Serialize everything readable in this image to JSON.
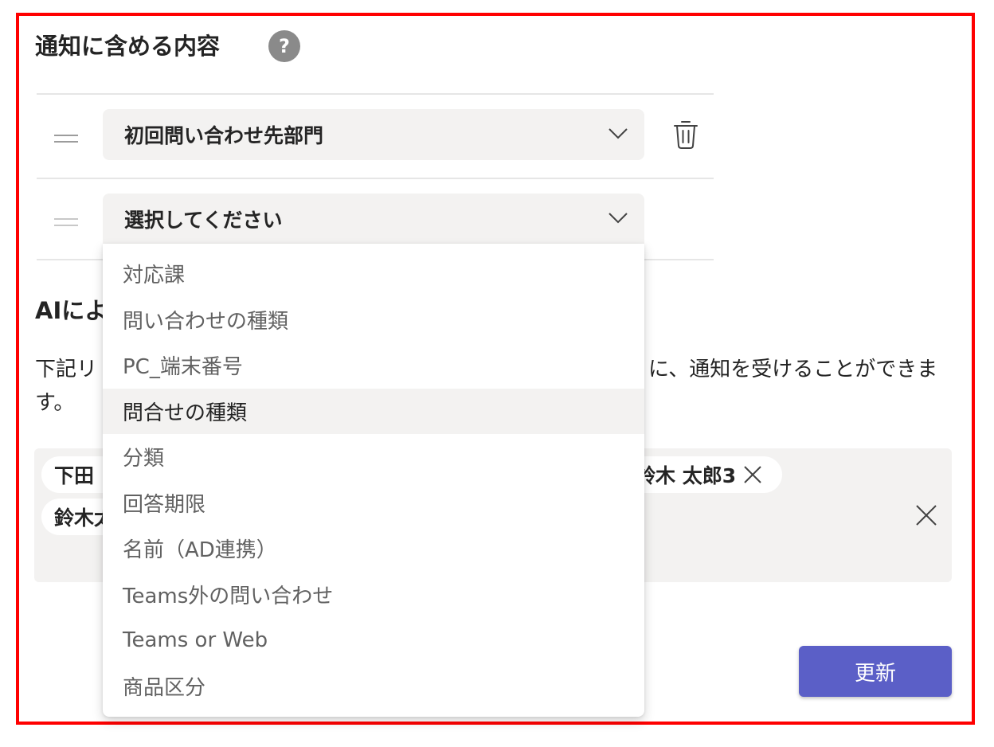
{
  "section": {
    "title": "通知に含める内容",
    "help_icon": "?"
  },
  "fields": [
    {
      "selected": "初回問い合わせ先部門",
      "icons": [
        "drag-handle-icon",
        "chevron-down-icon",
        "trash-icon"
      ]
    },
    {
      "selected": "選択してください",
      "icons": [
        "drag-handle-icon",
        "chevron-down-icon"
      ]
    }
  ],
  "dropdown": {
    "options": [
      "対応課",
      "問い合わせの種類",
      "PC_端末番号",
      "問合せの種類",
      "分類",
      "回答期限",
      "名前（AD連携）",
      "Teams外の問い合わせ",
      "Teams or Web",
      "商品区分"
    ],
    "hovered_index": 3
  },
  "ai_section": {
    "heading_visible": "AIによ",
    "description_line1_left": "下記リ",
    "description_line1_right": "に、通知を受けることができま",
    "description_line2": "す。"
  },
  "recipients": {
    "chips": [
      {
        "label": "下田"
      },
      {
        "label": "鈴木 太郎3"
      },
      {
        "label": "鈴木太"
      }
    ]
  },
  "actions": {
    "update_label": "更新"
  },
  "colors": {
    "primary": "#5b5fc7",
    "field_bg": "#f3f2f1",
    "frame_border": "#ff0000"
  }
}
